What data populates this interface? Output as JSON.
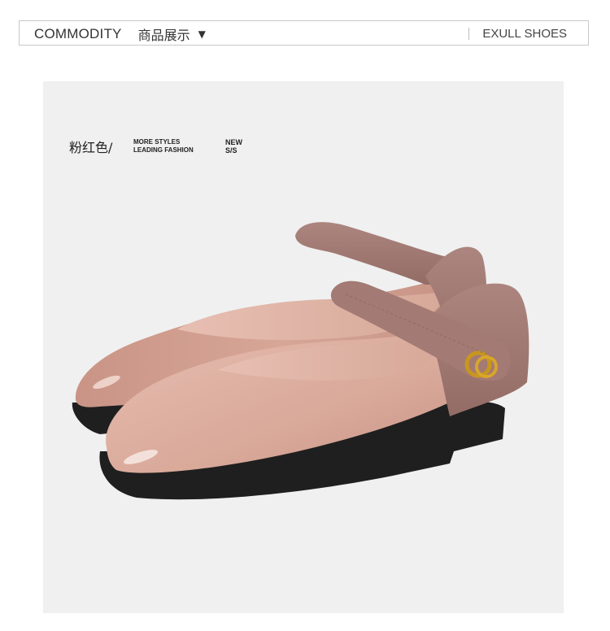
{
  "header": {
    "title": "COMMODITY",
    "subtitle": "商品展示",
    "caret": "▼",
    "brand": "EXULL SHOES"
  },
  "product": {
    "color_label": "粉红色/",
    "tagline_line1": "MORE STYLES",
    "tagline_line2": "LEADING FASHION",
    "season_line1": "NEW",
    "season_line2": "S/S"
  },
  "colors": {
    "photo_bg": "#f0f0f0",
    "patent_leather": "#d9a99a",
    "suede": "#a37a74",
    "sole": "#1f1f1f",
    "buckle": "#c8961f"
  },
  "icons": {
    "caret": "chevron-down-icon"
  }
}
